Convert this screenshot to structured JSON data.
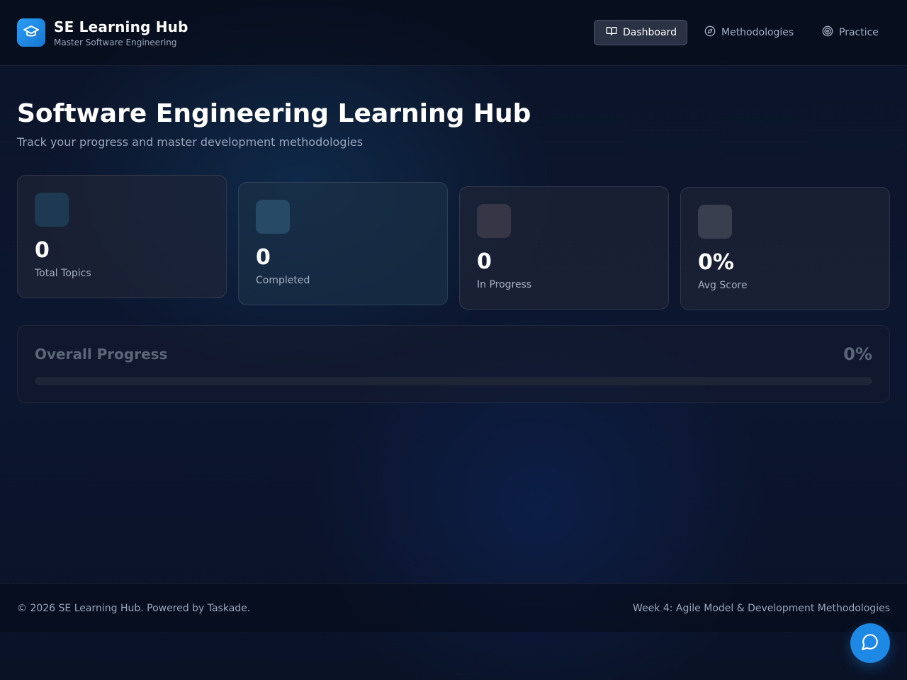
{
  "brand": {
    "title": "SE Learning Hub",
    "subtitle": "Master Software Engineering",
    "icon": "graduation-cap-icon",
    "accent": "#2a9df4"
  },
  "nav": {
    "items": [
      {
        "label": "Dashboard",
        "icon": "book-open-icon",
        "active": true
      },
      {
        "label": "Methodologies",
        "icon": "compass-icon",
        "active": false
      },
      {
        "label": "Practice",
        "icon": "target-icon",
        "active": false
      }
    ]
  },
  "hero": {
    "title": "Software Engineering Learning Hub",
    "subtitle": "Track your progress and master development methodologies"
  },
  "stats": [
    {
      "value": "0",
      "label": "Total Topics",
      "icon_color": "#1e3a52"
    },
    {
      "value": "0",
      "label": "Completed",
      "icon_color": "#274a66"
    },
    {
      "value": "0",
      "label": "In Progress",
      "icon_color": "#363646"
    },
    {
      "value": "0%",
      "label": "Avg Score",
      "icon_color": "#3a3f50"
    }
  ],
  "progress": {
    "title": "Overall Progress",
    "percent_label": "0%",
    "value": 0
  },
  "footer": {
    "left": "© 2026 SE Learning Hub. Powered by Taskade.",
    "right": "Week 4: Agile Model & Development Methodologies"
  },
  "chat": {
    "icon": "chat-bubble-icon",
    "color": "#1e88e5"
  }
}
